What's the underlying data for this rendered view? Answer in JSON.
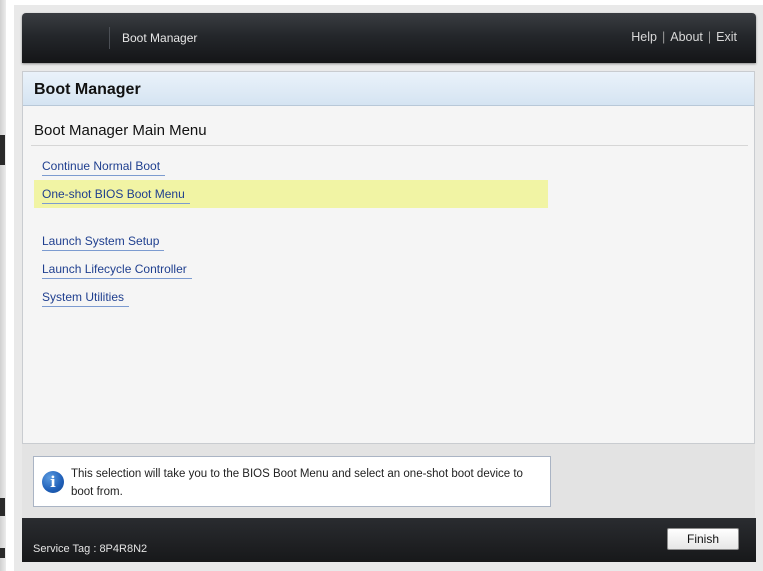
{
  "header": {
    "app_title": "Boot Manager",
    "links": {
      "help": "Help",
      "about": "About",
      "exit": "Exit"
    }
  },
  "panel": {
    "title": "Boot Manager",
    "menu_title": "Boot Manager Main Menu",
    "items": [
      {
        "label": "Continue Normal Boot",
        "selected": false
      },
      {
        "label": "One-shot BIOS Boot Menu",
        "selected": true
      },
      {
        "label": "Launch System Setup",
        "selected": false
      },
      {
        "label": "Launch Lifecycle Controller",
        "selected": false
      },
      {
        "label": "System Utilities",
        "selected": false
      }
    ]
  },
  "info": {
    "icon": "info-icon",
    "text": "This selection will take you to the BIOS Boot Menu and select an one-shot boot device to boot from."
  },
  "footer": {
    "service_tag": "Service Tag : 8P4R8N2",
    "finish_label": "Finish"
  },
  "colors": {
    "selected_row": "#f1f4a4",
    "link": "#1f3f8f",
    "header_bar": "#24272b",
    "info_icon": "#1f5fb8"
  }
}
